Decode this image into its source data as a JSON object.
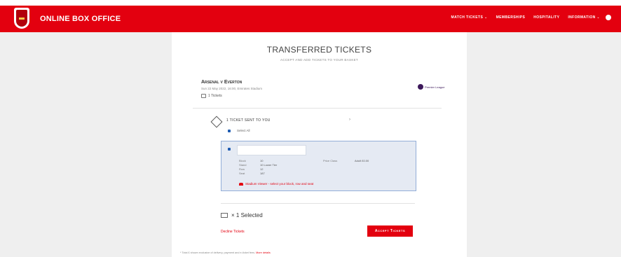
{
  "header": {
    "brand": "ONLINE BOX OFFICE",
    "nav": [
      {
        "label": "MATCH TICKETS ⌄"
      },
      {
        "label": "MEMBERSHIPS"
      },
      {
        "label": "HOSPITALITY"
      },
      {
        "label": "INFORMATION ⌄"
      }
    ]
  },
  "page": {
    "title": "TRANSFERRED TICKETS",
    "subtitle": "ACCEPT AND ADD TICKETS TO YOUR BASKET"
  },
  "match": {
    "title": "Arsenal v Everton",
    "meta": "Sun 22 May 2022, 16:00, Emirates Stadium",
    "ticket_count": "1 Tickets",
    "competition_logo_text": "Premier League"
  },
  "transfer": {
    "sent_label": "1 TICKET SENT TO YOU",
    "select_all": "Select All",
    "ticket": {
      "name_value": "",
      "block_label": "Block",
      "block_value": "10",
      "stand_label": "Stand",
      "stand_value": "10 Lower Tier",
      "row_label": "Row",
      "row_value": "12",
      "seat_label": "Seat",
      "seat_value": "187",
      "price_label": "Price Class",
      "price_value": "Adult £0.00",
      "stadium_link": "Stadium Viewer - select your block, row and seat"
    },
    "selected_text": "× 1 Selected",
    "decline_label": "Decline Tickets",
    "accept_label": "Accept Tickets"
  },
  "footer": {
    "note": "* Total £ shown exclusive of delivery, payment and e-ticket fees.",
    "more_link": "More details"
  },
  "colors": {
    "brand_red": "#e3000f",
    "card_bg": "#e5eaf3",
    "card_border": "#93aed8",
    "checkbox_blue": "#1f5cb2"
  },
  "icons": [
    "arsenal-crest",
    "user-icon",
    "ticket-icon",
    "premier-league-logo",
    "ticket-sent-icon",
    "chevron-down-icon",
    "stadium-icon",
    "selection-ticket-icon"
  ]
}
